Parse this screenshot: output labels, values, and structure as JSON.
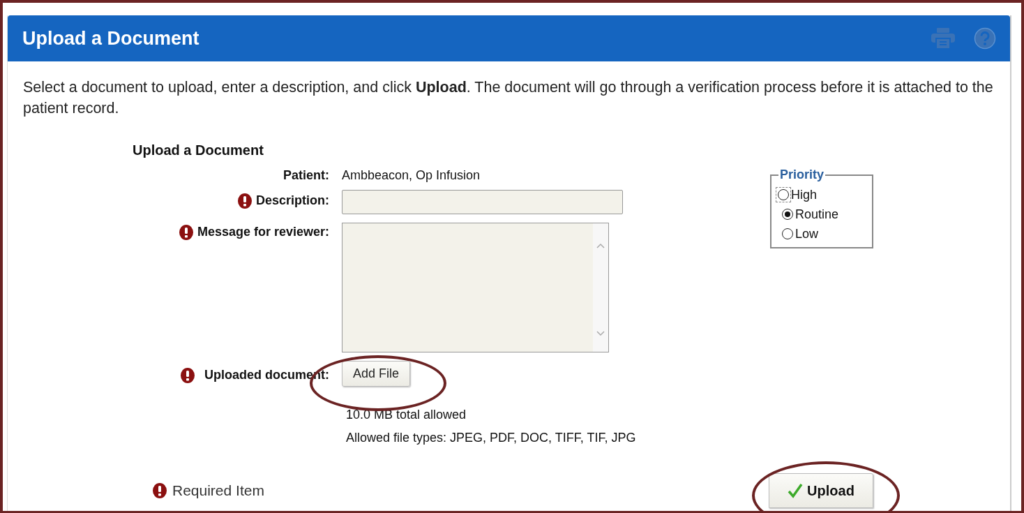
{
  "header": {
    "title": "Upload a Document"
  },
  "intro": "Select a document to upload, enter a description, and click **Upload**. The document will go through a verification process before it is attached to the patient record.",
  "form": {
    "heading": "Upload a Document",
    "fields": [
      {
        "kind": "text",
        "label": "Patient:",
        "required": false,
        "value": "Ambbeacon, Op Infusion"
      },
      {
        "kind": "input",
        "label": "Description:",
        "required": true
      },
      {
        "kind": "textarea",
        "label": "Message for reviewer:",
        "required": true
      },
      {
        "kind": "file",
        "label": "Uploaded document:",
        "required": true,
        "button": "Add File",
        "notes": [
          "10.0 MB total allowed",
          "Allowed file types: JPEG, PDF, DOC, TIFF, TIF, JPG"
        ]
      }
    ]
  },
  "priority": {
    "legend": "Priority",
    "options": [
      {
        "label": "High",
        "selected": false,
        "focused": true
      },
      {
        "label": "Routine",
        "selected": true,
        "focused": false
      },
      {
        "label": "Low",
        "selected": false,
        "focused": false
      }
    ]
  },
  "required_legend": "Required Item",
  "upload_button": "Upload"
}
